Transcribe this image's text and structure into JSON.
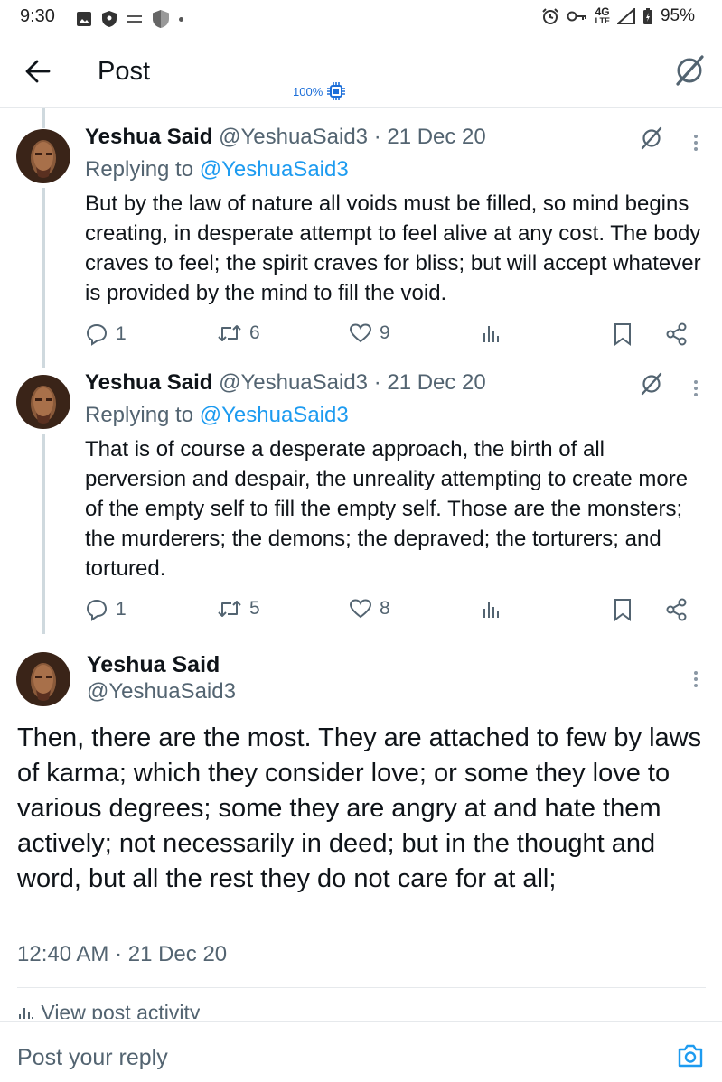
{
  "status_bar": {
    "time": "9:30",
    "network": "4G",
    "network_sub": "LTE",
    "battery": "95%"
  },
  "app_bar": {
    "title": "Post",
    "zoom_badge": "100%"
  },
  "replies": [
    {
      "name": "Yeshua Said",
      "meta": "@YeshuaSaid3 · 21 Dec 20",
      "replying_prefix": "Replying to ",
      "replying_handle": "@YeshuaSaid3",
      "text": "But by the law of nature all voids must be filled, so mind begins creating, in desperate attempt to feel alive at any cost.  The body craves to feel; the spirit craves for bliss; but will accept whatever is provided by the mind to fill the void.",
      "reply_count": "1",
      "repost_count": "6",
      "like_count": "9"
    },
    {
      "name": "Yeshua Said",
      "meta": "@YeshuaSaid3 · 21 Dec 20",
      "replying_prefix": "Replying to ",
      "replying_handle": "@YeshuaSaid3",
      "text": "That is of course a desperate approach, the birth of all perversion and despair, the unreality attempting to create more of the empty self to fill the empty self.  Those are the monsters; the murderers; the demons; the depraved; the torturers; and tortured.",
      "reply_count": "1",
      "repost_count": "5",
      "like_count": "8"
    }
  ],
  "main_post": {
    "name": "Yeshua Said",
    "handle": "@YeshuaSaid3",
    "text": "Then, there are the most.  They are attached to few by laws of karma; which they consider love; or some they love to various degrees; some they are angry at and hate them actively; not necessarily in deed; but in the thought and word, but all the rest they do not care for at all;",
    "timestamp": "12:40 AM · 21 Dec 20",
    "activity_label": "View post activity"
  },
  "reply_bar": {
    "placeholder": "Post your reply"
  },
  "colors": {
    "link": "#1d9bf0",
    "secondary_text": "#536471",
    "thread_line": "#cfd9de",
    "badge": "#1d6fd9"
  }
}
